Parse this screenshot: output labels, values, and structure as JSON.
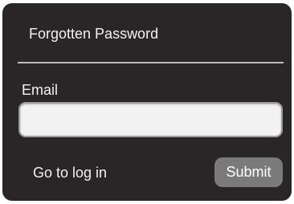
{
  "dialog": {
    "title": "Forgotten Password",
    "email_label": "Email",
    "email_value": "",
    "email_placeholder": "",
    "login_link": "Go to log in",
    "submit_label": "Submit"
  }
}
